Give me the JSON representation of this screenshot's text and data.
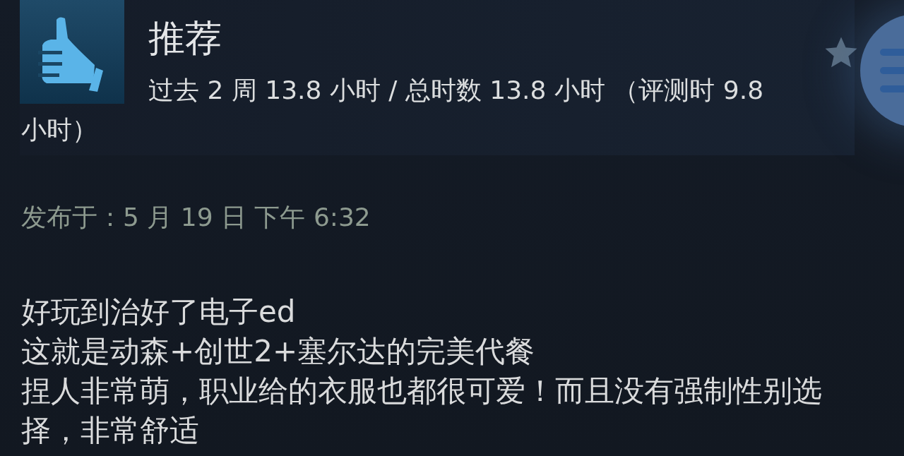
{
  "review": {
    "verdict": "推荐",
    "recommended": true,
    "hours": "过去 2 周 13.8 小时 / 总时数 13.8 小时 （评测时 9.8 小时）",
    "posted": "发布于：5 月 19 日 下午 6:32",
    "body": [
      "好玩到治好了电子ed",
      "这就是动森+创世2+塞尔达的完美代餐",
      "捏人非常萌，职业给的衣服也都很可爱！而且没有强制性别选择，非常舒适"
    ]
  }
}
